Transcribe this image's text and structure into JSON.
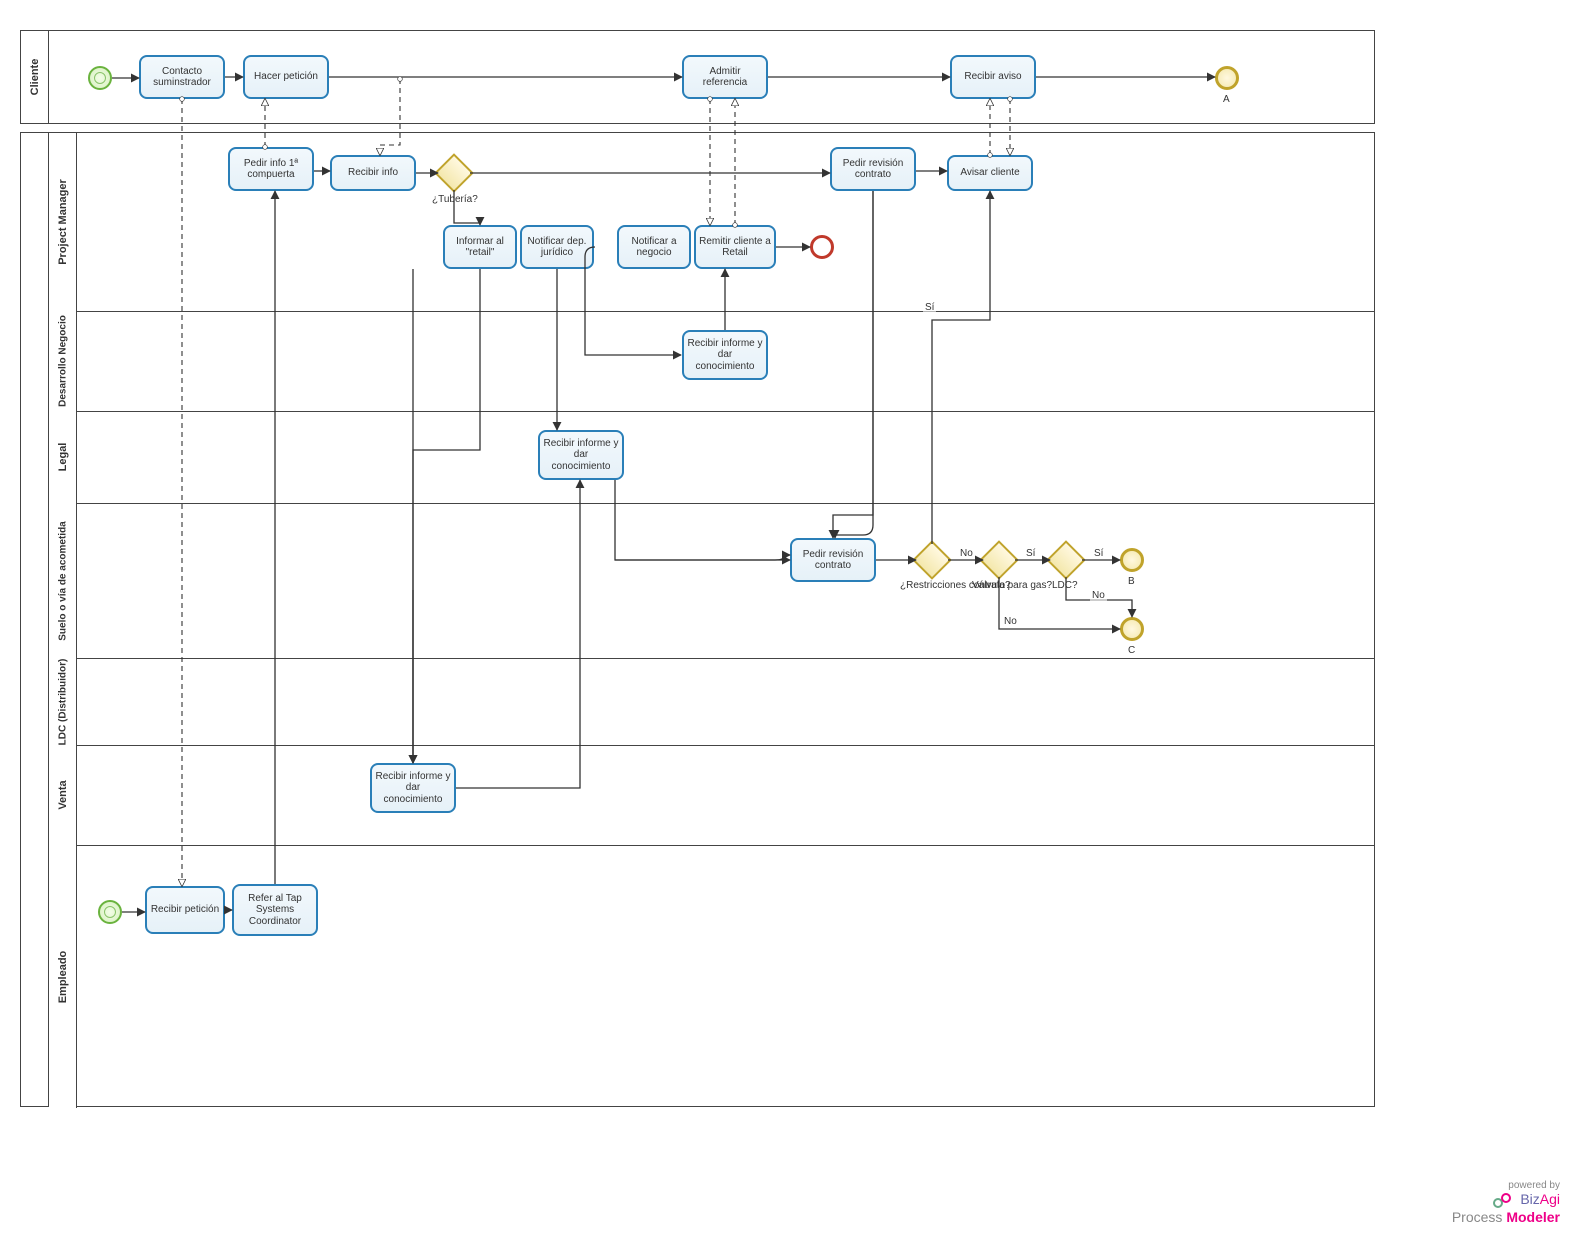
{
  "pools": {
    "cliente": "Cliente",
    "org": {
      "project_manager": "Project Manager",
      "desarrollo_negocio": "Desarrollo Negocio",
      "legal": "Legal",
      "suelo": "Suelo o vía de acometida",
      "ldc": "LDC (Distribuidor)",
      "venta": "Venta",
      "empleado": "Empleado"
    }
  },
  "tasks": {
    "contacto_suminstrador": "Contacto suminstrador",
    "hacer_peticion": "Hacer petición",
    "admitir_referencia": "Admitir referencia",
    "recibir_aviso": "Recibir aviso",
    "pedir_info_1a": "Pedir info  1ª compuerta",
    "recibir_info": "Recibir info",
    "informar_retail": "Informar al \"retail\"",
    "notificar_juridico": "Notificar dep. jurídico",
    "notificar_negocio": "Notificar a negocio",
    "remitir_cliente_retail": "Remitir cliente a Retail",
    "pedir_revision_contrato_pm": "Pedir revisión contrato",
    "avisar_cliente": "Avisar cliente",
    "recibir_informe_dn": "Recibir informe y dar conocimiento",
    "recibir_informe_legal": "Recibir informe y dar conocimiento",
    "pedir_revision_contrato_suelo": "Pedir revisión contrato",
    "recibir_informe_venta": "Recibir informe y dar conocimiento",
    "recibir_peticion": "Recibir petición",
    "refer_tap": "Refer al Tap Systems Coordinator"
  },
  "gateways": {
    "tuberia": "¿Tubería?",
    "restricciones": "¿Restricciones contrato?",
    "valvula_gas": "Válvula para gas?",
    "ldc": "LDC?"
  },
  "end_events": {
    "a": "A",
    "b": "B",
    "c": "C"
  },
  "edge_labels": {
    "si": "Sí",
    "no": "No"
  },
  "footer": {
    "powered_by": "powered by",
    "brand1a": "Biz",
    "brand1b": "Agi",
    "brand2a": "Process ",
    "brand2b": "Modeler"
  }
}
